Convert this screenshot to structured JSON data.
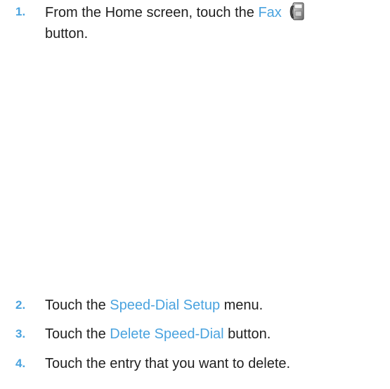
{
  "steps": [
    {
      "number": "1.",
      "before": "From the Home screen, touch the ",
      "link": "Fax",
      "after": " button.",
      "icon": "fax-icon"
    },
    {
      "number": "2.",
      "before": "Touch the ",
      "link": "Speed-Dial Setup",
      "after": " menu."
    },
    {
      "number": "3.",
      "before": "Touch the ",
      "link": "Delete Speed-Dial",
      "after": " button."
    },
    {
      "number": "4.",
      "text": "Touch the entry that you want to delete."
    }
  ],
  "colors": {
    "accent": "#4aa3df",
    "text": "#1f1f1f"
  }
}
